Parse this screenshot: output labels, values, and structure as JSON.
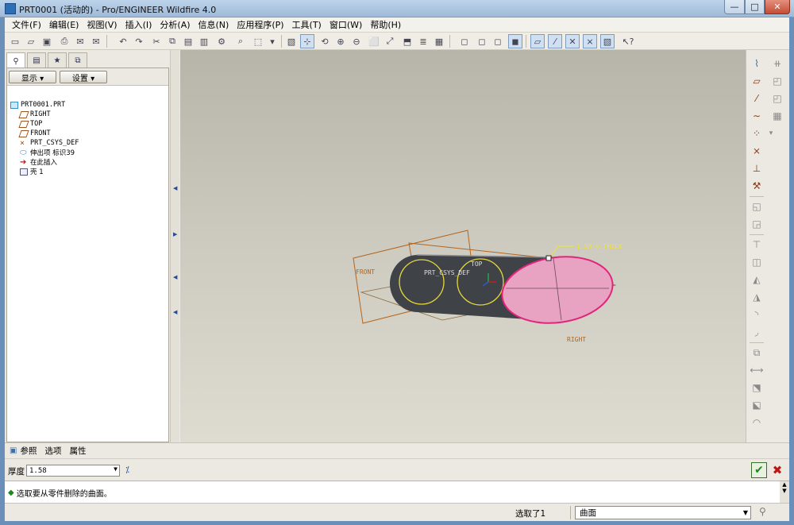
{
  "window": {
    "title": "PRT0001 (活动的) - Pro/ENGINEER Wildfire 4.0",
    "min": "—",
    "max": "□",
    "close": "✕"
  },
  "menu": [
    "文件(F)",
    "编辑(E)",
    "视图(V)",
    "插入(I)",
    "分析(A)",
    "信息(N)",
    "应用程序(P)",
    "工具(T)",
    "窗口(W)",
    "帮助(H)"
  ],
  "navigator": {
    "display_button": "显示 ▾",
    "settings_button": "设置 ▾",
    "tree": [
      {
        "label": "PRT0001.PRT",
        "icon": "part-icon"
      },
      {
        "label": "RIGHT",
        "icon": "datum-plane-icon"
      },
      {
        "label": "TOP",
        "icon": "datum-plane-icon"
      },
      {
        "label": "FRONT",
        "icon": "datum-plane-icon"
      },
      {
        "label": "PRT_CSYS_DEF",
        "icon": "csys-icon"
      },
      {
        "label": "伸出项 标识39",
        "icon": "protrusion-icon"
      },
      {
        "label": "在此插入",
        "icon": "insert-here-arrow-icon"
      },
      {
        "label": "壳 1",
        "icon": "shell-icon"
      }
    ]
  },
  "model_labels": {
    "front": "FRONT",
    "top": "TOP",
    "right": "RIGHT",
    "csys": "PRT_CSYS_DEF",
    "dimension": "1.58 O.THICK"
  },
  "dashboard": {
    "tabs": [
      "参照",
      "选项",
      "属性"
    ],
    "thickness_label": "厚度",
    "thickness_value": "1.58",
    "flip_icon": "flip-direction-icon"
  },
  "message": "选取要从零件删除的曲面。",
  "status": {
    "selection": "选取了1",
    "filter": "曲面"
  },
  "colors": {
    "selection_pink": "#e8a2c2",
    "highlight_magenta": "#e0267a",
    "datum_orange": "#b4651e",
    "dimension_yellow": "#f2e32a"
  }
}
